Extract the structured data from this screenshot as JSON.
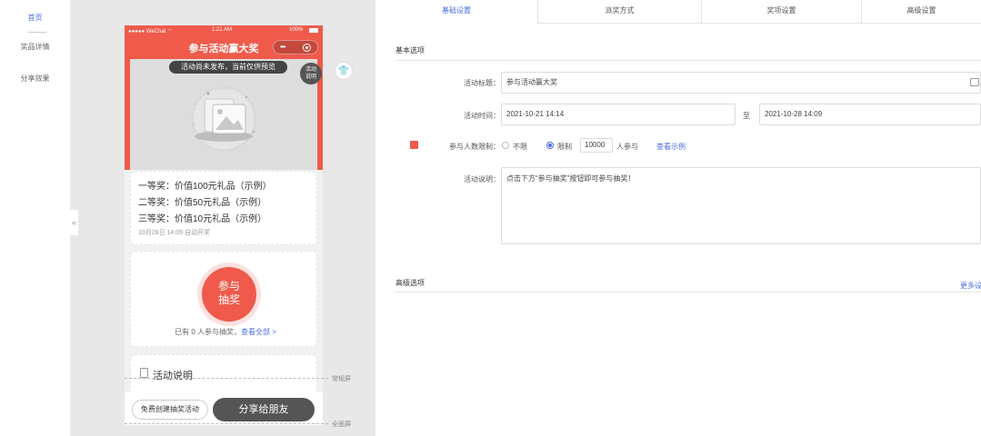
{
  "nav": {
    "items": [
      "首页",
      "奖品详情",
      "分享效果"
    ]
  },
  "phone": {
    "status": {
      "carrier": "●●●●● WeChat ⌔",
      "time": "1:21 AM",
      "battery": "100%"
    },
    "title": "参与活动赢大奖",
    "capsule_dots": "•••",
    "notice": "活动尚未发布，当前仅供预览",
    "badge_line1": "活动",
    "badge_line2": "说明",
    "prizes": [
      "一等奖：价值100元礼品（示例）",
      "二等奖：价值50元礼品（示例）",
      "三等奖：价值10元礼品（示例）"
    ],
    "auto_draw": "10月28日 14:09 自动开奖",
    "draw_line1": "参与",
    "draw_line2": "抽奖",
    "joined_prefix": "已有 0 人参与抽奖，",
    "joined_link": "查看全部 >",
    "desc_title": "活动说明",
    "free_btn": "免费创建抽奖活动",
    "share_btn": "分享给朋友"
  },
  "guides": {
    "normal": "常规屏",
    "full": "全面屏"
  },
  "tabs": [
    "基础设置",
    "派奖方式",
    "奖项设置",
    "高级设置"
  ],
  "basic": {
    "section": "基本选项",
    "title_label": "活动标题：",
    "title_value": "参与活动赢大奖",
    "time_label": "活动时间：",
    "start": "2021-10-21 14:14",
    "to": "至",
    "end": "2021-10-28 14:09",
    "limit_label": "参与人数限制：",
    "unlimited": "不限",
    "limited": "限制",
    "limit_value": "10000",
    "people_unit": "人参与",
    "example_link": "查看示例",
    "desc_label": "活动说明：",
    "desc_value": "点击下方“参与抽奖”按钮即可参与抽奖！"
  },
  "advanced": {
    "section": "高级选项",
    "more": "更多设"
  }
}
